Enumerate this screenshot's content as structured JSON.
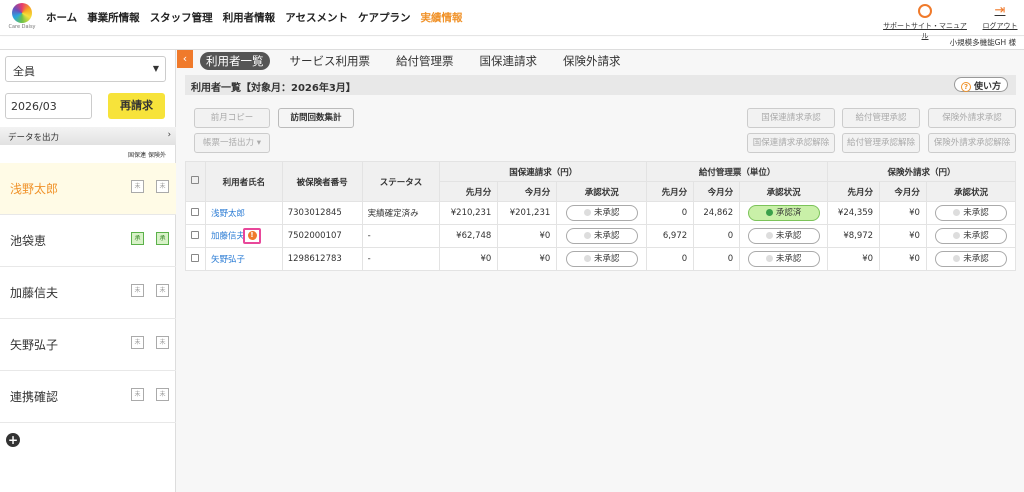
{
  "header": {
    "logo_text": "Care Daisy",
    "nav": [
      "ホーム",
      "事業所情報",
      "スタッフ管理",
      "利用者情報",
      "アセスメント",
      "ケアプラン",
      "実績情報"
    ],
    "active_nav": "実績情報",
    "support_label": "サポートサイト・マニュアル",
    "logout_label": "ログアウト",
    "facility": "小規模多機能GH 様"
  },
  "sidebar": {
    "filter": "全員",
    "month": "2026/03",
    "rebill_label": "再請求",
    "export_label": "データを出力",
    "col_kokuho": "国保連",
    "col_hoken": "保険外",
    "users": [
      {
        "name": "浅野太郎",
        "kokuho": "未",
        "hoken": "未"
      },
      {
        "name": "池袋恵",
        "kokuho": "承",
        "hoken": "承"
      },
      {
        "name": "加藤信夫",
        "kokuho": "未",
        "hoken": "未"
      },
      {
        "name": "矢野弘子",
        "kokuho": "未",
        "hoken": "未"
      },
      {
        "name": "連携確認",
        "kokuho": "未",
        "hoken": "未"
      }
    ]
  },
  "tabs": [
    "利用者一覧",
    "サービス利用票",
    "給付管理票",
    "国保連請求",
    "保険外請求"
  ],
  "title": "利用者一覧【対象月：2026年3月】",
  "help_label": "使い方",
  "buttons": {
    "prev_copy": "前月コピー",
    "visit_count": "訪問回数集計",
    "batch_print": "帳票一括出力",
    "kokuho_approve": "国保連請求承認",
    "kyufu_approve": "給付管理承認",
    "hoken_approve": "保険外請求承認",
    "kokuho_unapprove": "国保連請求承認解除",
    "kyufu_unapprove": "給付管理承認解除",
    "hoken_unapprove": "保険外請求承認解除"
  },
  "table": {
    "h_name": "利用者氏名",
    "h_number": "被保険者番号",
    "h_status": "ステータス",
    "g_kokuho": "国保連請求（円）",
    "g_kyufu": "給付管理票（単位）",
    "g_hoken": "保険外請求（円）",
    "prev": "先月分",
    "cur": "今月分",
    "approval": "承認状況",
    "rows": [
      {
        "name": "浅野太郎",
        "number": "7303012845",
        "status": "実績確定済み",
        "k_prev": "¥210,231",
        "k_cur": "¥201,231",
        "k_st": "未承認",
        "y_prev": "0",
        "y_cur": "24,862",
        "y_st": "承認済",
        "h_prev": "¥24,359",
        "h_cur": "¥0",
        "h_st": "未承認",
        "warn": false
      },
      {
        "name": "加藤信夫",
        "number": "7502000107",
        "status": "-",
        "k_prev": "¥62,748",
        "k_cur": "¥0",
        "k_st": "未承認",
        "y_prev": "6,972",
        "y_cur": "0",
        "y_st": "未承認",
        "h_prev": "¥8,972",
        "h_cur": "¥0",
        "h_st": "未承認",
        "warn": true
      },
      {
        "name": "矢野弘子",
        "number": "1298612783",
        "status": "-",
        "k_prev": "¥0",
        "k_cur": "¥0",
        "k_st": "未承認",
        "y_prev": "0",
        "y_cur": "0",
        "y_st": "未承認",
        "h_prev": "¥0",
        "h_cur": "¥0",
        "h_st": "未承認",
        "warn": false
      }
    ]
  }
}
